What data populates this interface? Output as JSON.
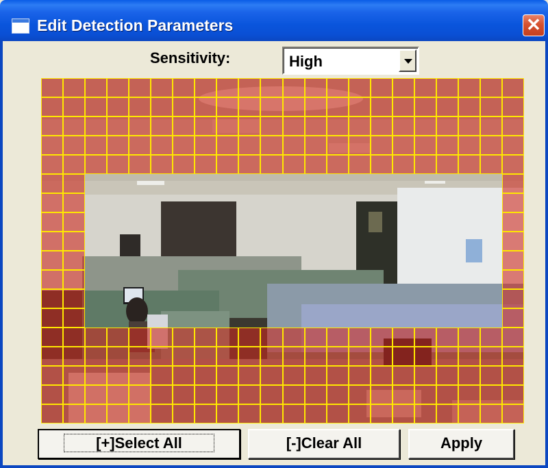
{
  "window": {
    "title": "Edit Detection Parameters",
    "close_glyph": "✕"
  },
  "sensitivity": {
    "label": "Sensitivity:",
    "value": "High"
  },
  "motion_grid": {
    "columns": 22,
    "rows": 18,
    "unselected_block": {
      "col_start": 2,
      "col_end": 21,
      "row_start": 5,
      "row_end": 13
    },
    "selected_color": "#cd281e",
    "grid_line_color": "#ffe800"
  },
  "buttons": {
    "select_all": "[+]Select All",
    "clear_all": "[-]Clear All",
    "apply": "Apply"
  }
}
